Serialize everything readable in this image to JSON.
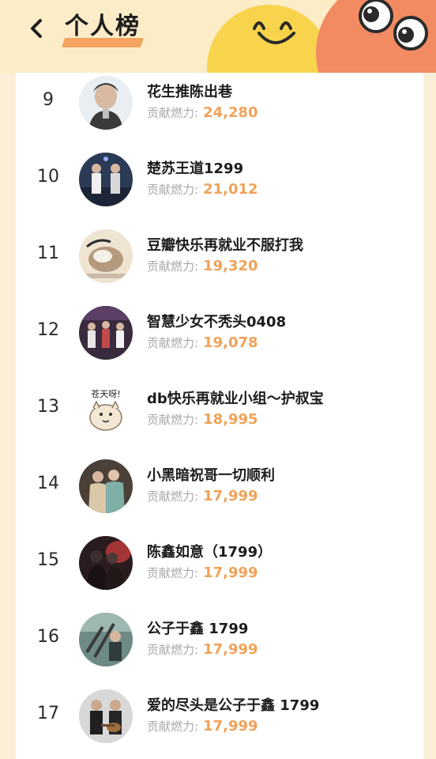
{
  "header": {
    "back_icon": "chevron-left-icon",
    "title": "个人榜"
  },
  "colors": {
    "background": "#fcefd8",
    "accent": "#f0a258",
    "title_underline": "#f4a25f",
    "deco_yellow": "#f7d44c",
    "deco_orange": "#f28a62"
  },
  "rows": [
    {
      "rank": "9",
      "name": "花生推陈出巷",
      "label": "贡献燃力:",
      "value": "24,280",
      "avatar": "person-avatar"
    },
    {
      "rank": "10",
      "name": "楚苏王道1299",
      "label": "贡献燃力:",
      "value": "21,012",
      "avatar": "duo-stage-avatar"
    },
    {
      "rank": "11",
      "name": "豆瓣快乐再就业不服打我",
      "label": "贡献燃力:",
      "value": "19,320",
      "avatar": "cartoon-avatar"
    },
    {
      "rank": "12",
      "name": "智慧少女不秃头0408",
      "label": "贡献燃力:",
      "value": "19,078",
      "avatar": "group-stage-avatar"
    },
    {
      "rank": "13",
      "name": "db快乐再就业小组～护叔宝",
      "label": "贡献燃力:",
      "value": "18,995",
      "avatar": "cat-sticker-avatar",
      "sticker_text": "苍天呀!"
    },
    {
      "rank": "14",
      "name": "小黑暗祝哥一切顺利",
      "label": "贡献燃力:",
      "value": "17,999",
      "avatar": "duo-avatar"
    },
    {
      "rank": "15",
      "name": "陈鑫如意（1799）",
      "label": "贡献燃力:",
      "value": "17,999",
      "avatar": "dark-stage-avatar"
    },
    {
      "rank": "16",
      "name": "公子于鑫 1799",
      "label": "贡献燃力:",
      "value": "17,999",
      "avatar": "outdoor-avatar"
    },
    {
      "rank": "17",
      "name": "爱的尽头是公子于鑫 1799",
      "label": "贡献燃力:",
      "value": "17,999",
      "avatar": "guitar-duo-avatar"
    }
  ]
}
